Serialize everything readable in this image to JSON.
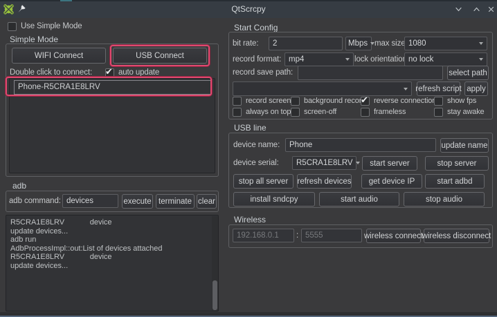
{
  "window": {
    "title": "QtScrcpy"
  },
  "left": {
    "use_simple_mode": {
      "label": "Use Simple Mode",
      "checked": false
    },
    "simple_mode": {
      "title": "Simple Mode",
      "wifi_connect_label": "WIFI Connect",
      "usb_connect_label": "USB Connect",
      "double_click_label": "Double click to connect:",
      "auto_update": {
        "label": "auto update",
        "checked": true
      },
      "device_list": [
        {
          "name": "Phone-R5CRA1E8LRV"
        }
      ]
    },
    "adb": {
      "title": "adb",
      "command_label": "adb command:",
      "command_value": "devices",
      "execute_label": "execute",
      "terminate_label": "terminate",
      "clear_label": "clear",
      "output_lines": [
        "R5CRA1E8LRV            device",
        "",
        "",
        "update devices...",
        "adb run",
        "AdbProcessImpl::out:List of devices attached",
        "R5CRA1E8LRV            device",
        "",
        "",
        "update devices..."
      ]
    }
  },
  "right": {
    "start_config": {
      "title": "Start Config",
      "bit_rate_label": "bit rate:",
      "bit_rate_value": "2",
      "bit_rate_unit": "Mbps",
      "max_size_label": "max size:",
      "max_size_value": "1080",
      "record_format_label": "record format:",
      "record_format_value": "mp4",
      "lock_orientation_label": "lock orientation:",
      "lock_orientation_value": "no lock",
      "record_save_path_label": "record save path:",
      "record_save_path_value": "",
      "select_path_label": "select path",
      "script_value": "",
      "refresh_script_label": "refresh script",
      "apply_label": "apply",
      "checkboxes": [
        {
          "label": "record screen",
          "checked": false
        },
        {
          "label": "background record",
          "checked": false
        },
        {
          "label": "reverse connection",
          "checked": true
        },
        {
          "label": "show fps",
          "checked": false
        },
        {
          "label": "always on top",
          "checked": false
        },
        {
          "label": "screen-off",
          "checked": false
        },
        {
          "label": "frameless",
          "checked": false
        },
        {
          "label": "stay awake",
          "checked": false
        }
      ]
    },
    "usb_line": {
      "title": "USB line",
      "device_name_label": "device name:",
      "device_name_value": "Phone",
      "update_name_label": "update name",
      "device_serial_label": "device serial:",
      "device_serial_value": "R5CRA1E8LRV",
      "start_server_label": "start server",
      "stop_server_label": "stop server",
      "stop_all_server_label": "stop all server",
      "refresh_devices_label": "refresh devices",
      "get_device_ip_label": "get device IP",
      "start_adbd_label": "start adbd",
      "install_sndcpy_label": "install sndcpy",
      "start_audio_label": "start audio",
      "stop_audio_label": "stop audio"
    },
    "wireless": {
      "title": "Wireless",
      "ip_placeholder": "192.168.0.1",
      "separator": ":",
      "port_placeholder": "5555",
      "wireless_connect_label": "wireless connect",
      "wireless_disconnect_label": "wireless disconnect"
    }
  },
  "colors": {
    "highlight_pink": "#e0496f",
    "android_green": "#97c23c",
    "titlebar": "#363c43",
    "window_bg": "#3a3a3c"
  }
}
